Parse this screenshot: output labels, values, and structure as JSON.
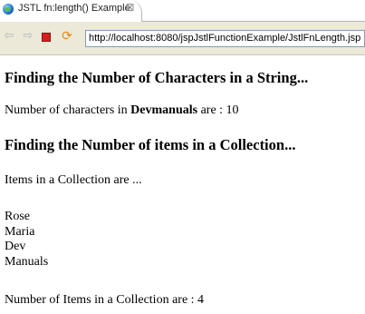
{
  "tab": {
    "title": "JSTL fn:length() Example",
    "close_glyph": "⊠",
    "icon": "globe-icon"
  },
  "toolbar": {
    "back_icon": "arrow-left-icon",
    "forward_icon": "arrow-right-icon",
    "stop_icon": "stop-icon",
    "refresh_icon": "refresh-icon",
    "url": "http://localhost:8080/jspJstlFunctionExample/JstlFnLength.jsp"
  },
  "page": {
    "heading1": "Finding the Number of Characters in a String...",
    "chars_prefix": "Number of characters in ",
    "chars_word": "Devmanuals",
    "chars_suffix": " are : 10",
    "heading2": "Finding the Number of items in a Collection...",
    "items_intro": "Items in a Collection are ...",
    "items": [
      "Rose",
      "Maria",
      "Dev",
      "Manuals"
    ],
    "items_count_text": "Number of Items in a Collection are : 4"
  }
}
